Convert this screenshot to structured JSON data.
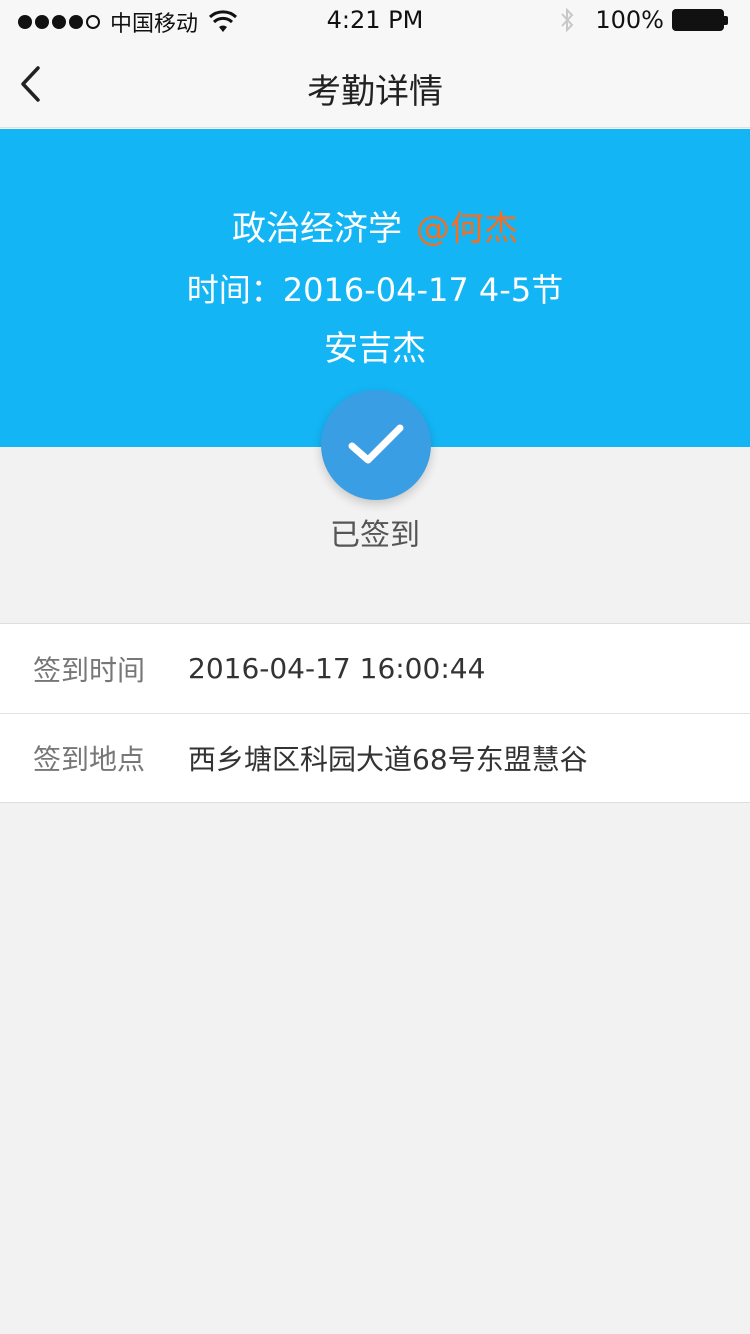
{
  "status_bar": {
    "carrier": "中国移动",
    "time": "4:21 PM",
    "battery": "100%"
  },
  "nav": {
    "title": "考勤详情"
  },
  "hero": {
    "course": "政治经济学",
    "teacher": "@何杰",
    "time_line": "时间：2016-04-17  4-5节",
    "student": "安吉杰"
  },
  "check_status": {
    "label": "已签到"
  },
  "details": {
    "rows": [
      {
        "label": "签到时间",
        "value": "2016-04-17  16:00:44"
      },
      {
        "label": "签到地点",
        "value": "西乡塘区科园大道68号东盟慧谷"
      }
    ]
  },
  "colors": {
    "hero_background": "#14b5f5",
    "teacher_accent": "#f26f24",
    "check_badge": "#3a9ee5",
    "page_background": "#f2f2f2"
  },
  "icons": [
    "signal-icon",
    "wifi-icon",
    "bluetooth-icon",
    "battery-icon",
    "back-arrow-icon",
    "checkmark-icon"
  ]
}
